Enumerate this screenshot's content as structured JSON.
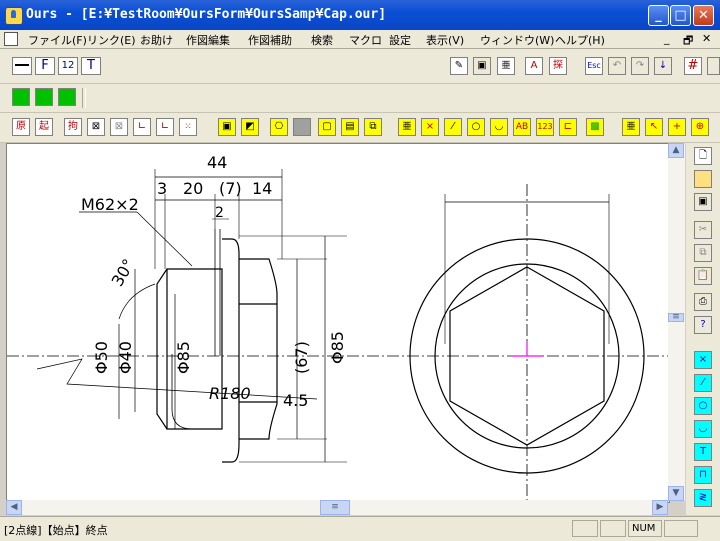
{
  "window": {
    "title": "Ours - [E:¥TestRoom¥OursForm¥OursSamp¥Cap.our]",
    "minimize": "_",
    "maximize": "□",
    "close": "✕"
  },
  "menu": {
    "items": [
      "ファイル(F)",
      "リンク(E)",
      "お助け",
      "作図編集",
      "作図補助",
      "検索",
      "マクロ",
      "設定",
      "表示(V)",
      "ウィンドウ(W)",
      "ヘルプ(H)"
    ],
    "mdi": [
      "_",
      "🗗",
      "✕"
    ]
  },
  "toolbar1": {
    "font_btn": "F",
    "size_btn": "12",
    "text_btn": "T",
    "text_value": "",
    "esc": "Esc"
  },
  "toolbar3": {
    "labels": [
      "原",
      "起",
      "拘",
      "AB",
      "123"
    ]
  },
  "drawing": {
    "dims": {
      "d44": "44",
      "d3": "3",
      "d20": "20",
      "d7": "(7)",
      "d14": "14",
      "d2": "2",
      "thread": "M62×2",
      "angle": "30°",
      "phi50": "Φ50",
      "phi40": "Φ40",
      "phi85a": "Φ85",
      "d67": "(67)",
      "phi85b": "Φ85",
      "r180": "R180",
      "d45": "4.5"
    }
  },
  "status": {
    "message": "[2点線]【始点】終点",
    "num": "NUM"
  },
  "colors": {
    "titlebar": "#0b4fd6",
    "center_mark": "#ff00ff",
    "canvas": "#ffffff"
  }
}
